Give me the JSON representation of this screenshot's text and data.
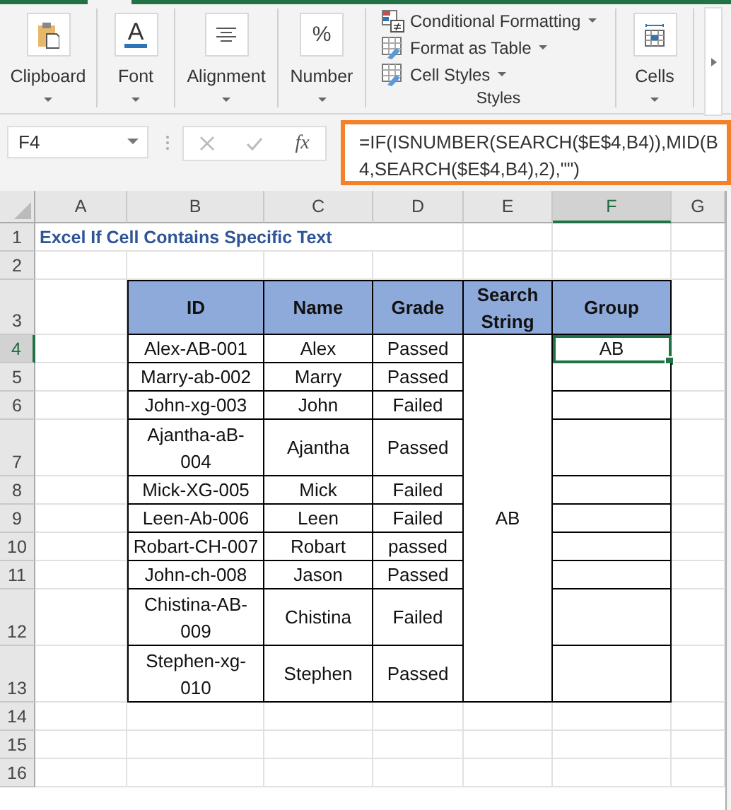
{
  "ribbon": {
    "groups": [
      {
        "kind": "clipboard",
        "label": "Clipboard"
      },
      {
        "kind": "font",
        "label": "Font",
        "glyph": "A"
      },
      {
        "kind": "alignment",
        "label": "Alignment"
      },
      {
        "kind": "number",
        "label": "Number",
        "glyph": "%"
      },
      {
        "kind": "styles",
        "label": "Styles",
        "commands": [
          {
            "kind": "conditional",
            "label": "Conditional Formatting"
          },
          {
            "kind": "table",
            "label": "Format as Table"
          },
          {
            "kind": "cellstyles",
            "label": "Cell Styles"
          }
        ]
      },
      {
        "kind": "cells",
        "label": "Cells"
      }
    ]
  },
  "formula_bar": {
    "name_box": "F4",
    "fx": "fx",
    "formula": "=IF(ISNUMBER(SEARCH($E$4,B4)),MID(B4,SEARCH($E$4,B4),2),\"\")"
  },
  "sheet": {
    "columns": [
      {
        "label": "A",
        "selected": false
      },
      {
        "label": "B",
        "selected": false
      },
      {
        "label": "C",
        "selected": false
      },
      {
        "label": "D",
        "selected": false
      },
      {
        "label": "E",
        "selected": false
      },
      {
        "label": "F",
        "selected": true
      },
      {
        "label": "G",
        "selected": false
      }
    ],
    "rows": [
      {
        "label": "1",
        "selected": false
      },
      {
        "label": "2",
        "selected": false
      },
      {
        "label": "3",
        "selected": false
      },
      {
        "label": "4",
        "selected": true
      },
      {
        "label": "5",
        "selected": false
      },
      {
        "label": "6",
        "selected": false
      },
      {
        "label": "7",
        "selected": false
      },
      {
        "label": "8",
        "selected": false
      },
      {
        "label": "9",
        "selected": false
      },
      {
        "label": "10",
        "selected": false
      },
      {
        "label": "11",
        "selected": false
      },
      {
        "label": "12",
        "selected": false
      },
      {
        "label": "13",
        "selected": false
      },
      {
        "label": "14",
        "selected": false
      },
      {
        "label": "15",
        "selected": false
      },
      {
        "label": "16",
        "selected": false
      }
    ],
    "title": "Excel If Cell Contains Specific Text",
    "table": {
      "headers": [
        "ID",
        "Name",
        "Grade",
        "Search String",
        "Group"
      ],
      "search_string": "AB",
      "rows": [
        {
          "id": "Alex-AB-001",
          "name": "Alex",
          "grade": "Passed",
          "group": "AB",
          "selected": true
        },
        {
          "id": "Marry-ab-002",
          "name": "Marry",
          "grade": "Passed",
          "selected": false
        },
        {
          "id": "John-xg-003",
          "name": "John",
          "grade": "Failed",
          "selected": false
        },
        {
          "id": "Ajantha-aB-004",
          "name": "Ajantha",
          "grade": "Passed",
          "selected": false
        },
        {
          "id": "Mick-XG-005",
          "name": "Mick",
          "grade": "Failed",
          "selected": false
        },
        {
          "id": "Leen-Ab-006",
          "name": "Leen",
          "grade": "Failed",
          "selected": false
        },
        {
          "id": "Robart-CH-007",
          "name": "Robart",
          "grade": "passed",
          "selected": false
        },
        {
          "id": "John-ch-008",
          "name": "Jason",
          "grade": "Passed",
          "selected": false
        },
        {
          "id": "Chistina-AB-009",
          "name": "Chistina",
          "grade": "Failed",
          "selected": false
        },
        {
          "id": "Stephen-xg-010",
          "name": "Stephen",
          "grade": "Passed",
          "selected": false
        }
      ]
    }
  }
}
